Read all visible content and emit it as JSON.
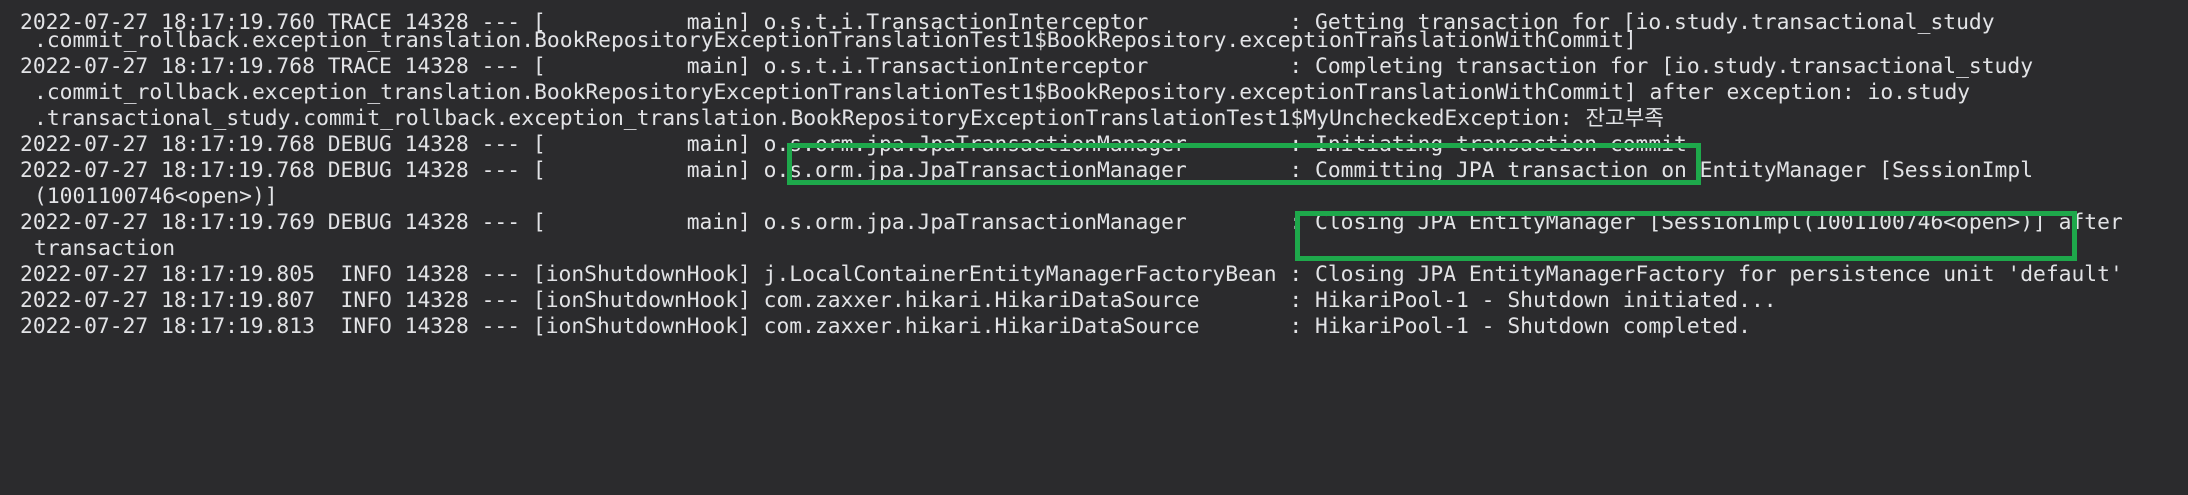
{
  "console": {
    "lines": [
      "2022-07-27 18:17:19.760 TRACE 14328 --- [           main] o.s.t.i.TransactionInterceptor           : Getting transaction for [io.study.transactional_study",
      ".commit_rollback.exception_translation.BookRepositoryExceptionTranslationTest1$BookRepository.exceptionTranslationWithCommit]",
      "2022-07-27 18:17:19.768 TRACE 14328 --- [           main] o.s.t.i.TransactionInterceptor           : Completing transaction for [io.study.transactional_study",
      ".commit_rollback.exception_translation.BookRepositoryExceptionTranslationTest1$BookRepository.exceptionTranslationWithCommit] after exception: io.study",
      ".transactional_study.commit_rollback.exception_translation.BookRepositoryExceptionTranslationTest1$MyUncheckedException: 잔고부족",
      "2022-07-27 18:17:19.768 DEBUG 14328 --- [           main] o.s.orm.jpa.JpaTransactionManager        : Initiating transaction commit",
      "2022-07-27 18:17:19.768 DEBUG 14328 --- [           main] o.s.orm.jpa.JpaTransactionManager        : Committing JPA transaction on EntityManager [SessionImpl",
      "(1001100746<open>)]",
      "2022-07-27 18:17:19.769 DEBUG 14328 --- [           main] o.s.orm.jpa.JpaTransactionManager        : Closing JPA EntityManager [SessionImpl(1001100746<open>)] after",
      "transaction",
      "2022-07-27 18:17:19.805  INFO 14328 --- [ionShutdownHook] j.LocalContainerEntityManagerFactoryBean : Closing JPA EntityManagerFactory for persistence unit 'default'",
      "2022-07-27 18:17:19.807  INFO 14328 --- [ionShutdownHook] com.zaxxer.hikari.HikariDataSource       : HikariPool-1 - Shutdown initiated...",
      "2022-07-27 18:17:19.813  INFO 14328 --- [ionShutdownHook] com.zaxxer.hikari.HikariDataSource       : HikariPool-1 - Shutdown completed."
    ]
  },
  "colors": {
    "background": "#2b2b2d",
    "text": "#e2e3e6",
    "highlight": "#1ea84b"
  }
}
